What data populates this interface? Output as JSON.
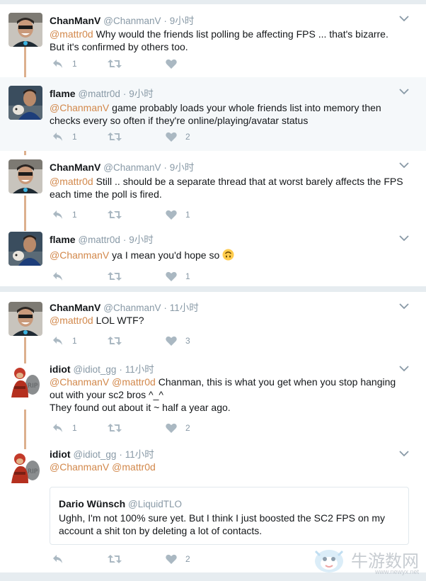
{
  "threads": [
    {
      "tweets": [
        {
          "name": "ChanManV",
          "handle": "@ChanmanV",
          "sep": "·",
          "time": "9小时",
          "text": [
            [
              {
                "t": "@mattr0d",
                "m": true
              },
              {
                "t": " Why would the friends list polling be affecting FPS ... that's bizarre."
              }
            ],
            [
              {
                "t": "But it's confirmed by others too."
              }
            ]
          ],
          "reply": "1",
          "retweet": "",
          "like": ""
        },
        {
          "name": "flame",
          "handle": "@mattr0d",
          "sep": "·",
          "time": "9小时",
          "text": [
            [
              {
                "t": "@ChanmanV",
                "m": true
              },
              {
                "t": " game probably loads your whole friends list into memory then"
              }
            ],
            [
              {
                "t": "checks every so often if they're online/playing/avatar status"
              }
            ]
          ],
          "reply": "1",
          "retweet": "",
          "like": "2"
        },
        {
          "name": "ChanManV",
          "handle": "@ChanmanV",
          "sep": "·",
          "time": "9小时",
          "text": [
            [
              {
                "t": "@mattr0d",
                "m": true
              },
              {
                "t": " Still .. should be a separate thread that at worst barely affects the FPS"
              }
            ],
            [
              {
                "t": "each time the poll is fired."
              }
            ]
          ],
          "reply": "1",
          "retweet": "",
          "like": "1"
        },
        {
          "name": "flame",
          "handle": "@mattr0d",
          "sep": "·",
          "time": "9小时",
          "text": [
            [
              {
                "t": "@ChanmanV",
                "m": true
              },
              {
                "t": " ya I mean you'd hope so "
              }
            ]
          ],
          "emoji": "upside-down-face",
          "reply": "",
          "retweet": "",
          "like": "1"
        }
      ]
    },
    {
      "tweets": [
        {
          "name": "ChanManV",
          "handle": "@ChanmanV",
          "sep": "·",
          "time": "11小时",
          "text": [
            [
              {
                "t": "@mattr0d",
                "m": true
              },
              {
                "t": " LOL WTF?"
              }
            ]
          ],
          "reply": "1",
          "retweet": "",
          "like": "3"
        },
        {
          "name": "idiot",
          "handle": "@idiot_gg",
          "sep": "·",
          "time": "11小时",
          "text": [
            [
              {
                "t": "@ChanmanV",
                "m": true
              },
              {
                "t": " "
              },
              {
                "t": "@mattr0d",
                "m": true
              },
              {
                "t": " Chanman, this is what you get when you stop hanging"
              }
            ],
            [
              {
                "t": "out with your sc2 bros ^_^"
              }
            ],
            [
              {
                "t": "They found out about it ~ half a year ago."
              }
            ]
          ],
          "reply": "1",
          "retweet": "",
          "like": "2"
        },
        {
          "name": "idiot",
          "handle": "@idiot_gg",
          "sep": "·",
          "time": "11小时",
          "text": [
            [
              {
                "t": "@ChanmanV",
                "m": true
              },
              {
                "t": " "
              },
              {
                "t": "@mattr0d",
                "m": true
              }
            ]
          ],
          "quote": {
            "name": "Dario Wünsch",
            "handle": "@LiquidTLO",
            "lines": [
              "Ughh, I'm not 100% sure yet. But I think I just boosted the SC2 FPS on my",
              "account a shit ton by deleting a lot of contacts."
            ]
          },
          "reply": "",
          "retweet": "",
          "like": "2"
        }
      ]
    }
  ],
  "watermark": {
    "text": "牛游数网",
    "url": "www.newyx.net"
  },
  "colors": {
    "mention": "#d2884b",
    "connector": "#dcb08e",
    "muted": "#8899a6",
    "highlight": "#f5f8fa"
  }
}
